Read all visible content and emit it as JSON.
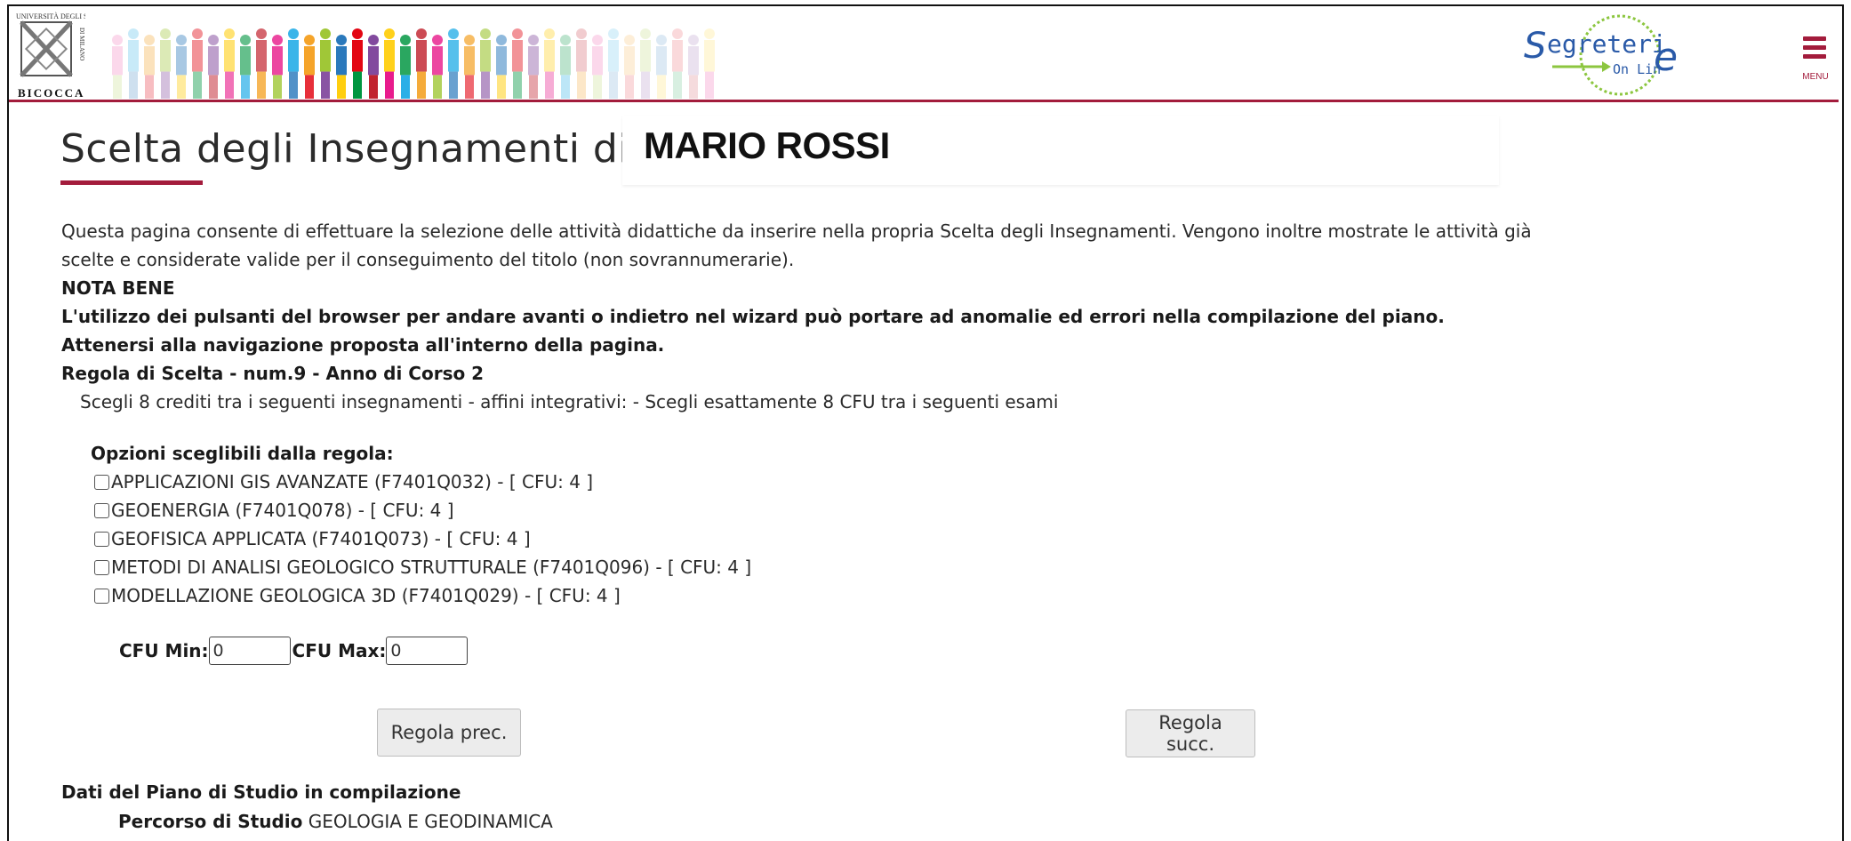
{
  "header": {
    "university_logo_text": "BICOCCA",
    "university_logo_side_text": "UNIVERSITÀ DEGLI STUDI DI MILANO",
    "segreterie_logo_text": "Segreterie",
    "segreterie_logo_sub": "On Line",
    "menu_label": "MENU",
    "accent_color": "#a31c3c"
  },
  "page": {
    "title": "Scelta degli Insegnamenti di:",
    "student_name": "MARIO ROSSI"
  },
  "intro": {
    "description": "Questa pagina consente di effettuare la selezione delle attività didattiche da inserire nella propria Scelta degli Insegnamenti. Vengono inoltre mostrate le attività già scelte e considerate valide per il conseguimento del titolo (non sovrannumerarie).",
    "note_heading": "NOTA BENE",
    "note_text": "L'utilizzo dei pulsanti del browser per andare avanti o indietro nel wizard può portare ad anomalie ed errori nella compilazione del piano. Attenersi alla navigazione proposta all'interno della pagina."
  },
  "rule": {
    "heading": "Regola di Scelta - num.9 - Anno di Corso 2",
    "description": "Scegli 8 crediti tra i seguenti insegnamenti - affini integrativi: - Scegli esattamente 8 CFU tra i seguenti esami",
    "options_title": "Opzioni sceglibili dalla regola:",
    "options": [
      {
        "label": "APPLICAZIONI GIS AVANZATE (F7401Q032) - [ CFU: 4 ]",
        "checked": false
      },
      {
        "label": "GEOENERGIA (F7401Q078) - [ CFU: 4 ]",
        "checked": false
      },
      {
        "label": "GEOFISICA APPLICATA (F7401Q073) - [ CFU: 4 ]",
        "checked": false
      },
      {
        "label": "METODI DI ANALISI GEOLOGICO STRUTTURALE (F7401Q096) - [ CFU: 4 ]",
        "checked": false
      },
      {
        "label": "MODELLAZIONE GEOLOGICA 3D (F7401Q029) - [ CFU: 4 ]",
        "checked": false
      }
    ]
  },
  "cfu": {
    "min_label": "CFU Min:",
    "min_value": "0",
    "max_label": "CFU Max:",
    "max_value": "0"
  },
  "nav": {
    "prev_label": "Regola prec.",
    "next_label": "Regola succ."
  },
  "plan": {
    "title": "Dati del Piano di Studio in compilazione",
    "path_label": "Percorso di Studio",
    "path_value": "GEOLOGIA E GEODINAMICA"
  }
}
